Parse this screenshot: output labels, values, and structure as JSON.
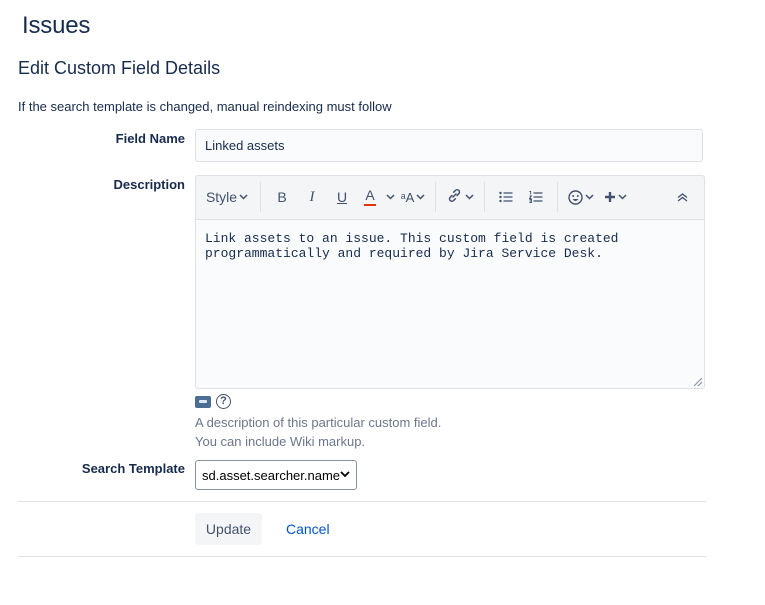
{
  "page": {
    "title": "Issues"
  },
  "form": {
    "heading": "Edit Custom Field Details",
    "notice": "If the search template is changed, manual reindexing must follow",
    "field_name": {
      "label": "Field Name",
      "value": "Linked assets"
    },
    "description": {
      "label": "Description",
      "value": "Link assets to an issue. This custom field is created\nprogrammatically and required by Jira Service Desk.",
      "hint_line1": "A description of this particular custom field.",
      "hint_line2": "You can include Wiki markup."
    },
    "search_template": {
      "label": "Search Template",
      "selected": "sd.asset.searcher.name"
    },
    "buttons": {
      "update": "Update",
      "cancel": "Cancel"
    }
  },
  "toolbar": {
    "style_label": "Style",
    "bold": "B",
    "italic": "I",
    "underline": "U",
    "text_color": "A",
    "text_format": "ᵃA",
    "help_glyph": "?"
  },
  "colors": {
    "text_color_bar": "#de350b",
    "link": "#0052cc"
  }
}
